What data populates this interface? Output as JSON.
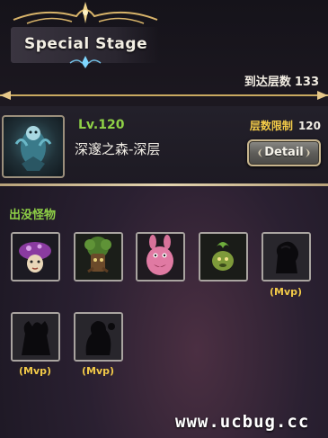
{
  "header": {
    "title": "Special Stage",
    "reach_label": "到达层数",
    "reach_value": "133"
  },
  "stage": {
    "level": "Lv.120",
    "name": "深邃之森-深层",
    "limit_label": "层数限制",
    "limit_value": "120",
    "detail_button": "Detail"
  },
  "monsters": {
    "section_title": "出没怪物",
    "items": [
      {
        "icon": "mushroom-monster-icon",
        "mvp": ""
      },
      {
        "icon": "tree-monster-icon",
        "mvp": ""
      },
      {
        "icon": "pink-beast-monster-icon",
        "mvp": ""
      },
      {
        "icon": "plant-blob-monster-icon",
        "mvp": ""
      },
      {
        "icon": "mvp-silhouette-icon",
        "mvp": "(Mvp)"
      },
      {
        "icon": "mvp-silhouette-icon",
        "mvp": "(Mvp)"
      },
      {
        "icon": "mvp-silhouette-icon",
        "mvp": "(Mvp)"
      }
    ]
  },
  "watermark": "www.ucbug.cc",
  "colors": {
    "accent_green": "#8fd146",
    "accent_gold": "#f2ca48",
    "frame_gold": "#c7b58e"
  }
}
